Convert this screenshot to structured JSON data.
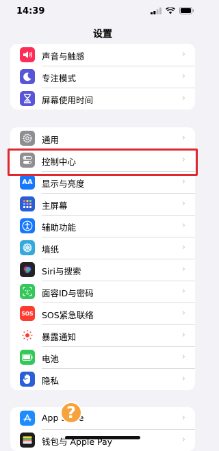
{
  "status_bar": {
    "time": "14:39"
  },
  "nav": {
    "title": "设置"
  },
  "groups": [
    [
      {
        "label": "声音与触感",
        "icon": "speaker-icon",
        "color": "#ff2d55"
      },
      {
        "label": "专注模式",
        "icon": "moon-icon",
        "color": "#5856d6"
      },
      {
        "label": "屏幕使用时间",
        "icon": "hourglass-icon",
        "color": "#5856d6"
      }
    ],
    [
      {
        "label": "通用",
        "icon": "gear-icon",
        "color": "#8e8e93"
      },
      {
        "label": "控制中心",
        "icon": "toggles-icon",
        "color": "#8e8e93"
      },
      {
        "label": "显示与亮度",
        "icon": "display-aa-icon",
        "color": "#1677ff",
        "icon_text": "AA"
      },
      {
        "label": "主屏幕",
        "icon": "home-screen-icon",
        "color": "#2b5fd9"
      },
      {
        "label": "辅助功能",
        "icon": "accessibility-icon",
        "color": "#1677ff"
      },
      {
        "label": "墙纸",
        "icon": "wallpaper-flower-icon",
        "color": "#34aadc"
      },
      {
        "label": "Siri与搜索",
        "icon": "siri-icon",
        "color": "#222222"
      },
      {
        "label": "面容ID与密码",
        "icon": "face-id-icon",
        "color": "#34c759"
      },
      {
        "label": "SOS紧急联络",
        "icon": "sos-icon",
        "color": "#ff3b30",
        "icon_text": "SOS"
      },
      {
        "label": "暴露通知",
        "icon": "exposure-icon",
        "color": "#ffffff"
      },
      {
        "label": "电池",
        "icon": "battery-icon",
        "color": "#34c759"
      },
      {
        "label": "隐私",
        "icon": "hand-icon",
        "color": "#2b5fd9"
      }
    ],
    [
      {
        "label": "App Store",
        "icon": "app-store-icon",
        "color": "#1c8cff"
      },
      {
        "label": "钱包与 Apple Pay",
        "icon": "wallet-icon",
        "color": "#1c1c1e"
      }
    ]
  ],
  "chevron": "›",
  "help_glyph": "?",
  "highlight_color": "#e0282f"
}
